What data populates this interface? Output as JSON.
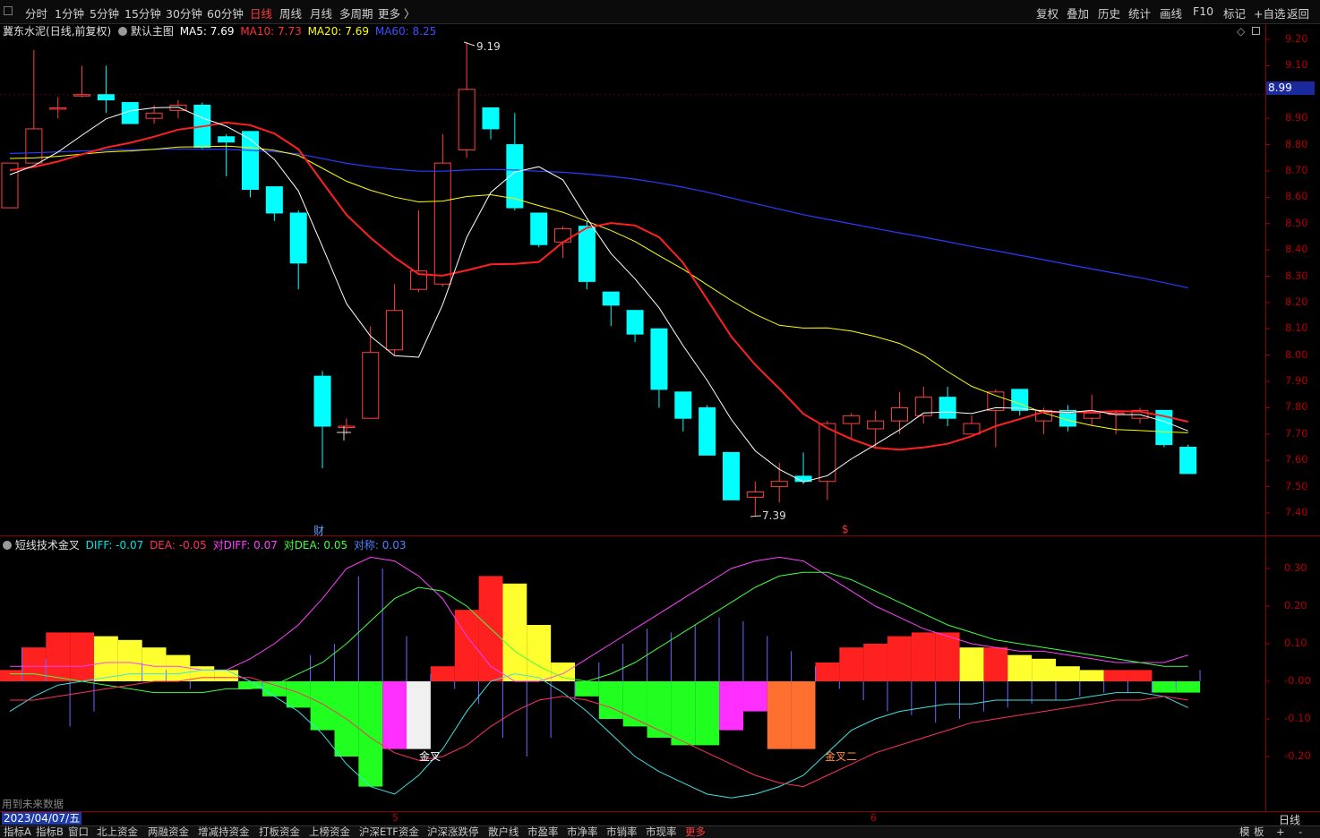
{
  "toolbar": {
    "tabs": [
      "分时",
      "1分钟",
      "5分钟",
      "15分钟",
      "30分钟",
      "60分钟",
      "日线",
      "周线",
      "月线",
      "多周期",
      "更多 〉"
    ],
    "active_tab": "日线",
    "right_buttons": [
      "复权",
      "叠加",
      "历史",
      "统计",
      "画线",
      "F10",
      "标记",
      "+自选",
      "返回"
    ]
  },
  "main_panel": {
    "stock_name": "冀东水泥",
    "period_note": "(日线,前复权)",
    "template": "默认主图",
    "ma5": "MA5: 7.69",
    "ma10": "MA10: 7.73",
    "ma20": "MA20: 7.69",
    "ma60": "MA60: 8.25",
    "high_label": "9.19",
    "low_label": "7.39",
    "current_price": "8.99",
    "event_marker_1": "财",
    "event_marker_2": "$",
    "colors": {
      "ma5": "#ffffff",
      "ma10": "#ff2020",
      "ma20": "#ffff00",
      "ma60": "#2a3cff",
      "up": "#ff4040",
      "down": "#00ffff"
    }
  },
  "price_axis": [
    "9.20",
    "9.10",
    "9.00",
    "8.90",
    "8.80",
    "8.70",
    "8.60",
    "8.50",
    "8.40",
    "8.30",
    "8.20",
    "8.10",
    "8.00",
    "7.90",
    "7.80",
    "7.70",
    "7.60",
    "7.50",
    "7.40"
  ],
  "indicator_panel": {
    "name": "短线技术金叉",
    "diff": "DIFF: -0.07",
    "dea": "DEA: -0.05",
    "rel_diff": "对DIFF: 0.07",
    "rel_dea": "对DEA: 0.05",
    "sym": "对称: 0.03",
    "golden_cross_1": "金叉",
    "golden_cross_2": "金叉二",
    "axis": [
      "0.30",
      "0.20",
      "0.10",
      "-0.00",
      "-0.10",
      "-0.20"
    ],
    "future_data_note": "用到未来数据"
  },
  "time_axis": {
    "date": "2023/04/07/五",
    "month_5": "5",
    "month_6": "6",
    "period_label": "日线"
  },
  "bottom_tabs": [
    "指标A",
    "指标B",
    "窗口",
    "北上资金",
    "两融资金",
    "增减持资金",
    "打板资金",
    "上榜资金",
    "沪深ETF资金",
    "沪深涨跌停",
    "散户线",
    "市盈率",
    "市净率",
    "市销率",
    "市现率",
    "更多"
  ],
  "bottom_right": [
    "模",
    "板",
    "+",
    "-"
  ],
  "chart_data": {
    "type": "candlestick",
    "series_ohlc": [
      [
        8.56,
        8.73,
        8.56,
        8.73
      ],
      [
        8.73,
        8.86,
        9.16,
        8.73
      ],
      [
        8.94,
        8.94,
        8.98,
        8.9
      ],
      [
        8.99,
        8.99,
        9.1,
        8.98
      ],
      [
        8.99,
        8.97,
        9.1,
        8.92
      ],
      [
        8.96,
        8.88,
        8.96,
        8.88
      ],
      [
        8.9,
        8.92,
        8.95,
        8.88
      ],
      [
        8.93,
        8.95,
        8.97,
        8.9
      ],
      [
        8.95,
        8.79,
        8.96,
        8.78
      ],
      [
        8.83,
        8.81,
        8.84,
        8.68
      ],
      [
        8.85,
        8.63,
        8.85,
        8.6
      ],
      [
        8.64,
        8.54,
        8.64,
        8.51
      ],
      [
        8.54,
        8.35,
        8.55,
        8.25
      ],
      [
        7.92,
        7.73,
        7.94,
        7.57
      ],
      [
        7.73,
        7.73,
        7.76,
        7.7
      ],
      [
        7.76,
        8.01,
        8.11,
        7.76
      ],
      [
        8.02,
        8.17,
        8.27,
        8.0
      ],
      [
        8.25,
        8.32,
        8.55,
        8.24
      ],
      [
        8.27,
        8.73,
        8.84,
        8.26
      ],
      [
        8.78,
        9.01,
        9.19,
        8.75
      ],
      [
        8.94,
        8.86,
        8.94,
        8.82
      ],
      [
        8.8,
        8.56,
        8.92,
        8.55
      ],
      [
        8.54,
        8.42,
        8.54,
        8.41
      ],
      [
        8.43,
        8.48,
        8.49,
        8.37
      ],
      [
        8.49,
        8.28,
        8.51,
        8.25
      ],
      [
        8.24,
        8.19,
        8.24,
        8.11
      ],
      [
        8.17,
        8.08,
        8.17,
        8.05
      ],
      [
        8.1,
        7.87,
        8.1,
        7.8
      ],
      [
        7.86,
        7.76,
        7.86,
        7.71
      ],
      [
        7.8,
        7.62,
        7.81,
        7.62
      ],
      [
        7.63,
        7.45,
        7.63,
        7.45
      ],
      [
        7.46,
        7.48,
        7.52,
        7.39
      ],
      [
        7.5,
        7.52,
        7.59,
        7.44
      ],
      [
        7.54,
        7.52,
        7.63,
        7.51
      ],
      [
        7.52,
        7.74,
        7.75,
        7.45
      ],
      [
        7.74,
        7.77,
        7.78,
        7.68
      ],
      [
        7.72,
        7.75,
        7.79,
        7.65
      ],
      [
        7.75,
        7.8,
        7.86,
        7.7
      ],
      [
        7.77,
        7.84,
        7.88,
        7.74
      ],
      [
        7.84,
        7.76,
        7.88,
        7.73
      ],
      [
        7.7,
        7.74,
        7.77,
        7.7
      ],
      [
        7.79,
        7.86,
        7.87,
        7.65
      ],
      [
        7.87,
        7.79,
        7.87,
        7.77
      ],
      [
        7.75,
        7.79,
        7.8,
        7.7
      ],
      [
        7.79,
        7.73,
        7.81,
        7.71
      ],
      [
        7.76,
        7.78,
        7.85,
        7.73
      ],
      [
        7.78,
        7.78,
        7.79,
        7.7
      ],
      [
        7.76,
        7.79,
        7.8,
        7.74
      ],
      [
        7.79,
        7.66,
        7.79,
        7.65
      ],
      [
        7.65,
        7.55,
        7.66,
        7.55
      ]
    ],
    "ylim": [
      7.35,
      9.25
    ]
  }
}
